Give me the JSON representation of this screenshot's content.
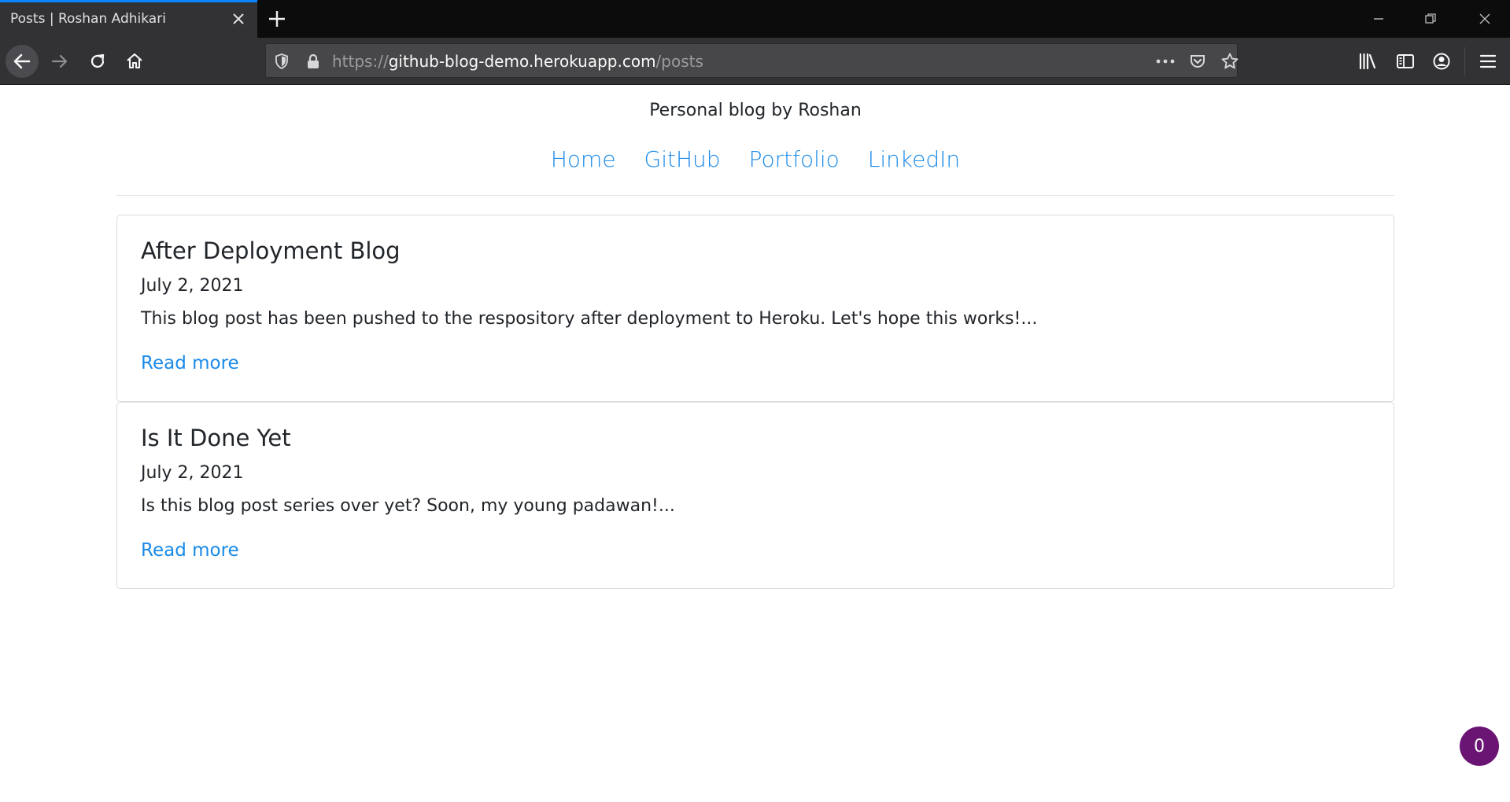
{
  "browser": {
    "tab_title": "Posts | Roshan Adhikari",
    "url_prefix": "https://",
    "url_domain": "github-blog-demo.herokuapp.com",
    "url_path": "/posts",
    "tab_accent_color": "#0a84ff"
  },
  "site": {
    "tagline": "Personal blog by Roshan",
    "nav": [
      "Home",
      "GitHub",
      "Portfolio",
      "LinkedIn"
    ],
    "link_color": "#1a8ae8"
  },
  "posts": [
    {
      "title": "After Deployment Blog",
      "date": "July 2, 2021",
      "excerpt": "This blog post has been pushed to the respository after deployment to Heroku. Let's hope this works!...",
      "link": "Read more"
    },
    {
      "title": "Is It Done Yet",
      "date": "July 2, 2021",
      "excerpt": "Is this blog post series over yet? Soon, my young padawan!...",
      "link": "Read more"
    }
  ],
  "badge": {
    "count": "0",
    "color": "#6a1473"
  }
}
